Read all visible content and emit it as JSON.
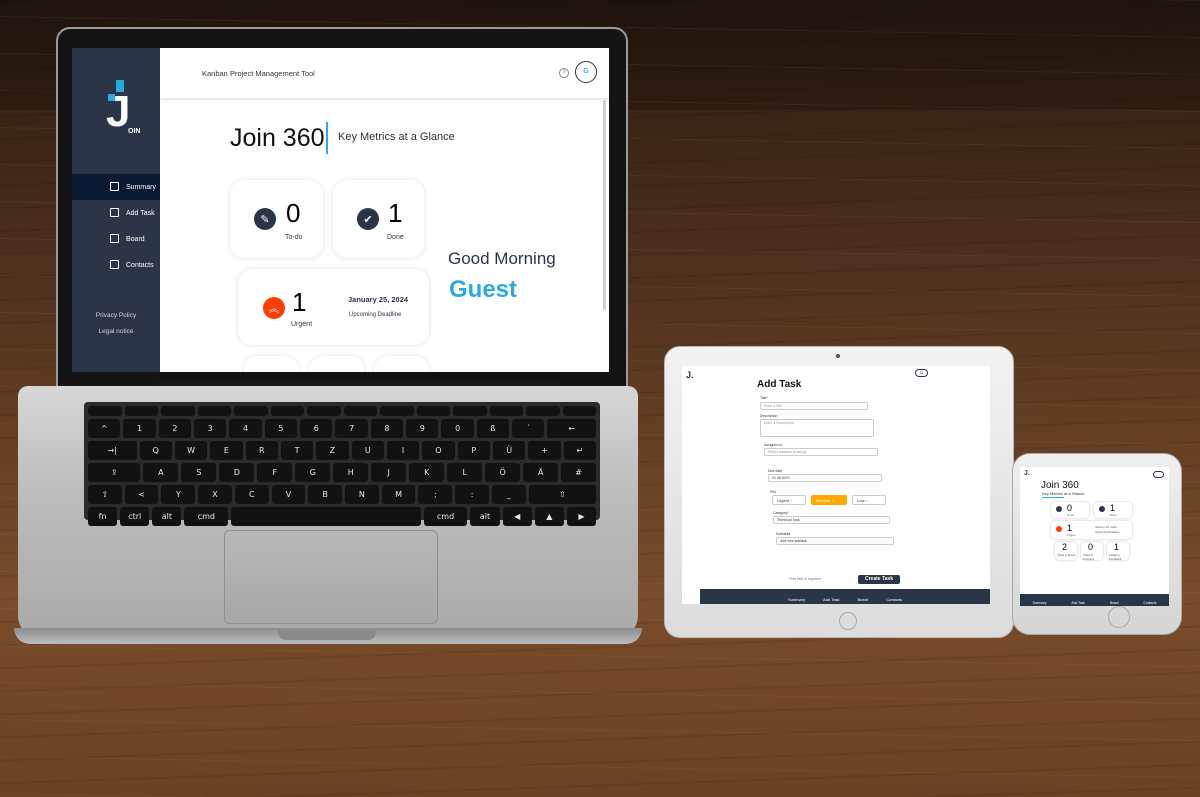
{
  "laptop": {
    "header_title": "Kanban Project Management Tool",
    "help_icon": "?",
    "avatar_initial": "G",
    "logo_text": "OIN",
    "nav": [
      "Summary",
      "Add Task",
      "Board",
      "Contacts"
    ],
    "legal": [
      "Privacy Policy",
      "Legal notice"
    ],
    "page_title": "Join 360",
    "page_subtitle": "Key Metrics at a Glance",
    "todo": {
      "value": "0",
      "label": "To-do"
    },
    "done": {
      "value": "1",
      "label": "Done"
    },
    "urgent": {
      "value": "1",
      "label": "Urgent",
      "date": "January 25, 2024",
      "date_label": "Upcoming Deadline"
    },
    "greeting": "Good Morning",
    "user_name": "Guest"
  },
  "tablet": {
    "logo": "J.",
    "avatar": "G",
    "title": "Add Task",
    "title_label": "Title*",
    "title_placeholder": "Enter a title",
    "description_label": "Description",
    "description_placeholder": "Enter a Description",
    "assigned_label": "Assigned to",
    "assigned_placeholder": "Select contacts to assign",
    "due_label": "Due date",
    "due_value": "01.08.2023",
    "prio_label": "Prio",
    "prio": [
      "Urgent",
      "Medium",
      "Low"
    ],
    "category_label": "Category*",
    "category_value": "Technical Task",
    "subtasks_label": "Subtasks",
    "subtasks_placeholder": "Add new subtask",
    "required_note": "*This field is required",
    "create_button": "Create Task",
    "nav": [
      "Summary",
      "Add Task",
      "Board",
      "Contacts"
    ]
  },
  "phone": {
    "logo": "J.",
    "title": "Join 360",
    "subtitle": "Key Metrics at a Glance",
    "todo": {
      "value": "0",
      "label": "To-do"
    },
    "done": {
      "value": "1",
      "label": "Done"
    },
    "urgent": {
      "value": "1",
      "label": "Urgent",
      "date": "January 25, 2024",
      "date_label": "Upcoming Deadline"
    },
    "board": [
      {
        "value": "2",
        "label": "Tasks in Board"
      },
      {
        "value": "0",
        "label": "Tasks in Progress"
      },
      {
        "value": "1",
        "label": "Awaiting Feedback"
      }
    ],
    "nav": [
      "Summary",
      "Add Task",
      "Board",
      "Contacts"
    ]
  },
  "colors": {
    "sidebar": "#2a3647",
    "accent": "#29abe2",
    "urgent": "#ff3d00",
    "medium": "#ffa800",
    "low": "#7ae229"
  }
}
